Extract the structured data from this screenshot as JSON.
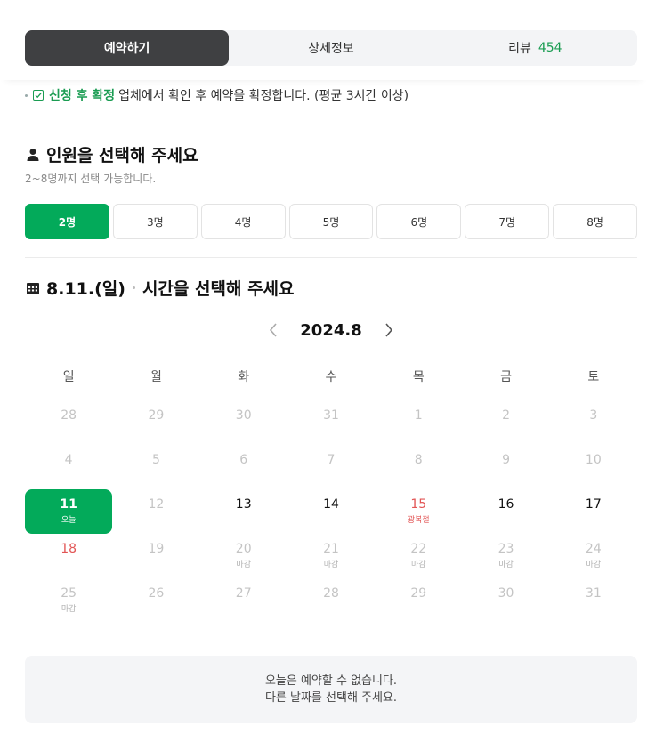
{
  "tabs": [
    {
      "label": "예약하기",
      "active": true
    },
    {
      "label": "상세정보",
      "active": false
    },
    {
      "label": "리뷰",
      "count": "454",
      "active": false
    }
  ],
  "notice": {
    "highlight": "신청 후 확정",
    "text": "업체에서 확인 후 예약을 확정합니다. (평균 3시간 이상)"
  },
  "people_section": {
    "title": "인원을 선택해 주세요",
    "subtitle": "2~8명까지 선택 가능합니다.",
    "options": [
      "2명",
      "3명",
      "4명",
      "5명",
      "6명",
      "7명",
      "8명"
    ],
    "selected_index": 0
  },
  "time_section": {
    "date": "8.11.(일)",
    "title": "시간을 선택해 주세요"
  },
  "calendar": {
    "month_label": "2024.8",
    "weekdays": [
      "일",
      "월",
      "화",
      "수",
      "목",
      "금",
      "토"
    ],
    "weeks": [
      [
        {
          "d": "28",
          "s": "dim"
        },
        {
          "d": "29",
          "s": "dim"
        },
        {
          "d": "30",
          "s": "dim"
        },
        {
          "d": "31",
          "s": "dim"
        },
        {
          "d": "1",
          "s": "dim"
        },
        {
          "d": "2",
          "s": "dim"
        },
        {
          "d": "3",
          "s": "dim"
        }
      ],
      [
        {
          "d": "4",
          "s": "dim"
        },
        {
          "d": "5",
          "s": "dim"
        },
        {
          "d": "6",
          "s": "dim"
        },
        {
          "d": "7",
          "s": "dim"
        },
        {
          "d": "8",
          "s": "dim"
        },
        {
          "d": "9",
          "s": "dim"
        },
        {
          "d": "10",
          "s": "dim"
        }
      ],
      [
        {
          "d": "11",
          "s": "today",
          "sub": "오늘"
        },
        {
          "d": "12",
          "s": "dim"
        },
        {
          "d": "13",
          "s": "avail"
        },
        {
          "d": "14",
          "s": "avail"
        },
        {
          "d": "15",
          "s": "holiday",
          "sub": "광복절"
        },
        {
          "d": "16",
          "s": "avail"
        },
        {
          "d": "17",
          "s": "avail"
        }
      ],
      [
        {
          "d": "18",
          "s": "sun"
        },
        {
          "d": "19",
          "s": "dim"
        },
        {
          "d": "20",
          "s": "closed",
          "sub": "마감"
        },
        {
          "d": "21",
          "s": "closed",
          "sub": "마감"
        },
        {
          "d": "22",
          "s": "closed",
          "sub": "마감"
        },
        {
          "d": "23",
          "s": "closed",
          "sub": "마감"
        },
        {
          "d": "24",
          "s": "closed",
          "sub": "마감"
        }
      ],
      [
        {
          "d": "25",
          "s": "closed",
          "sub": "마감"
        },
        {
          "d": "26",
          "s": "dim"
        },
        {
          "d": "27",
          "s": "dim"
        },
        {
          "d": "28",
          "s": "dim"
        },
        {
          "d": "29",
          "s": "dim"
        },
        {
          "d": "30",
          "s": "dim"
        },
        {
          "d": "31",
          "s": "dim"
        }
      ]
    ]
  },
  "message": {
    "line1": "오늘은 예약할 수 없습니다.",
    "line2": "다른 날짜를 선택해 주세요."
  },
  "colors": {
    "accent_green": "#03aa5a",
    "active_tab": "#3f4042",
    "holiday_red": "#e25555"
  }
}
